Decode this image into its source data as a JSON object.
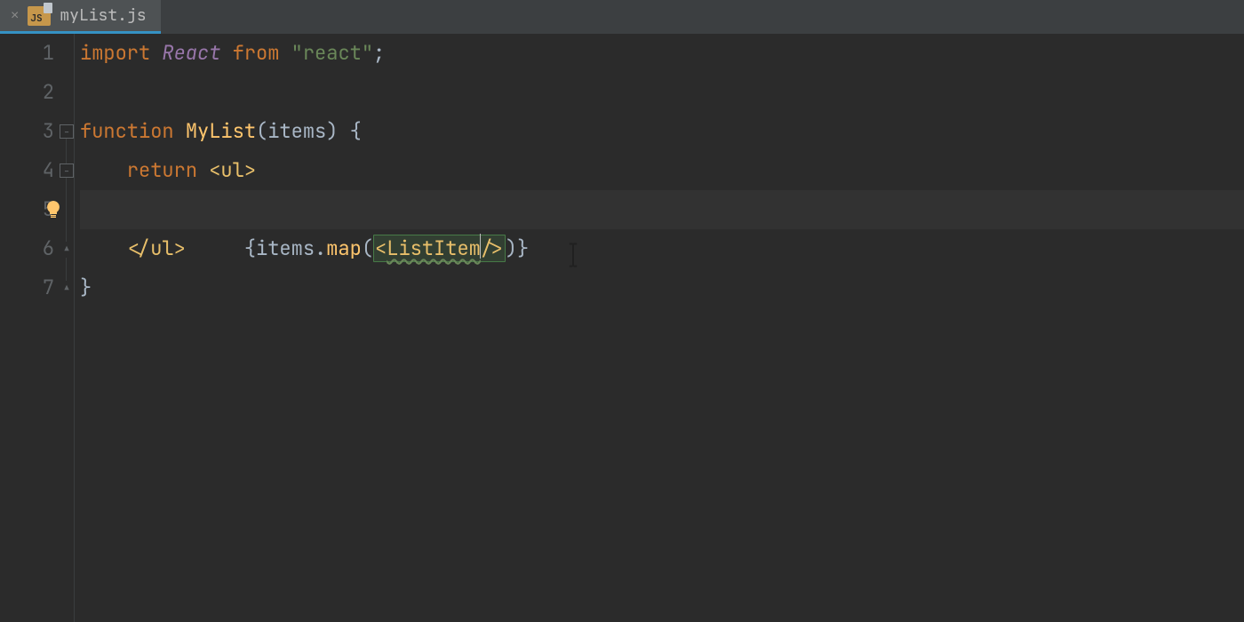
{
  "tab": {
    "close_glyph": "×",
    "filename": "myList.js",
    "filetype_badge": "JS"
  },
  "gutter": {
    "lines": [
      "1",
      "2",
      "3",
      "4",
      "5",
      "6",
      "7"
    ]
  },
  "code": {
    "l1": {
      "import": "import",
      "react": "React",
      "from": "from",
      "str": "\"react\"",
      "semi": ";"
    },
    "l3": {
      "function": "function",
      "name": "MyList",
      "params": "items",
      "brace": "{"
    },
    "l4": {
      "return": "return",
      "open_ul": "<ul>"
    },
    "l5": {
      "open_brace": "{",
      "items": "items",
      "dot": ".",
      "map": "map",
      "open_paren": "(",
      "open_tag": "<",
      "component": "ListItem",
      "self_close": "/>",
      "close_paren": ")",
      "close_brace": "}"
    },
    "l6": {
      "close_ul": "</ul>"
    },
    "l7": {
      "close_fn": "}"
    }
  },
  "icons": {
    "fold_minus": "−",
    "fold_close": "⌄"
  }
}
